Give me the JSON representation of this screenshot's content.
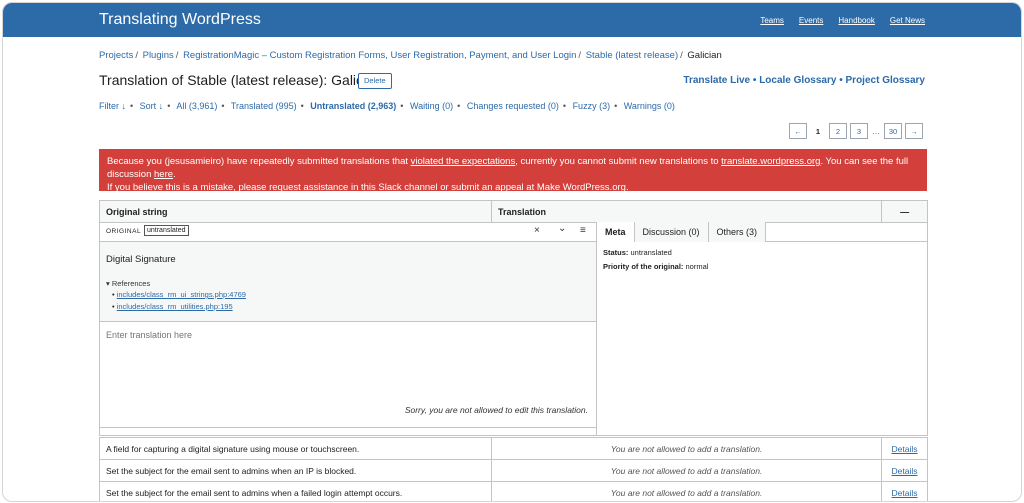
{
  "header": {
    "brand": "Translating WordPress",
    "nav": [
      "Teams",
      "Events",
      "Handbook",
      "Get News"
    ]
  },
  "breadcrumb": {
    "items": [
      "Projects",
      "Plugins",
      "RegistrationMagic – Custom Registration Forms, User Registration, Payment, and User Login",
      "Stable (latest release)"
    ],
    "current": "Galician"
  },
  "page": {
    "title": "Translation of Stable (latest release): Galician",
    "delete_label": "Delete",
    "right_links": [
      "Translate Live",
      "Locale Glossary",
      "Project Glossary"
    ]
  },
  "filters": {
    "filter_label": "Filter ↓",
    "sort_label": "Sort ↓",
    "items": [
      "All (3,961)",
      "Translated (995)",
      "Untranslated (2,963)",
      "Waiting (0)",
      "Changes requested (0)",
      "Fuzzy (3)",
      "Warnings (0)"
    ]
  },
  "pager": {
    "prev": "←",
    "current": "1",
    "pages": [
      "2",
      "3"
    ],
    "ellipsis": "…",
    "last": "30",
    "next": "→"
  },
  "alert": {
    "p1": "Because you (jesusamieiro) have repeatedly submitted translations that ",
    "link1": "violated the expectations",
    "p2": ", currently you cannot submit new translations to ",
    "link2": "translate.wordpress.org",
    "p3": ". You can see the full discussion ",
    "link3": "here",
    "p4": ".",
    "p5": "If you believe this is a mistake, please request assistance in this ",
    "link4": "Slack channel",
    "p6": " or submit an appeal at ",
    "link5": "Make WordPress.org",
    "p7": "."
  },
  "table": {
    "col_original": "Original string",
    "col_translation": "Translation",
    "collapse": "—"
  },
  "editor": {
    "original_label": "ORIGINAL",
    "badge": "untranslated",
    "close_glyph": "×",
    "down_glyph": "⌄",
    "menu_glyph": "≡",
    "original_text": "Digital Signature",
    "references_label": "▾ References",
    "references": [
      "includes/class_rm_ui_strings.php:4769",
      "includes/class_rm_utilities.php:195"
    ],
    "placeholder": "Enter translation here",
    "not_allowed": "Sorry, you are not allowed to edit this translation.",
    "tabs": [
      "Meta",
      "Discussion (0)",
      "Others (3)"
    ],
    "meta": {
      "status_label": "Status:",
      "status_value": "untranslated",
      "priority_label": "Priority of the original:",
      "priority_value": "normal"
    }
  },
  "rows": [
    {
      "original": "A field for capturing a digital signature using mouse or touchscreen.",
      "message": "You are not allowed to add a translation.",
      "action": "Details"
    },
    {
      "original": "Set the subject for the email sent to admins when an IP is blocked.",
      "message": "You are not allowed to add a translation.",
      "action": "Details"
    },
    {
      "original": "Set the subject for the email sent to admins when a failed login attempt occurs.",
      "message": "You are not allowed to add a translation.",
      "action": "Details"
    }
  ]
}
